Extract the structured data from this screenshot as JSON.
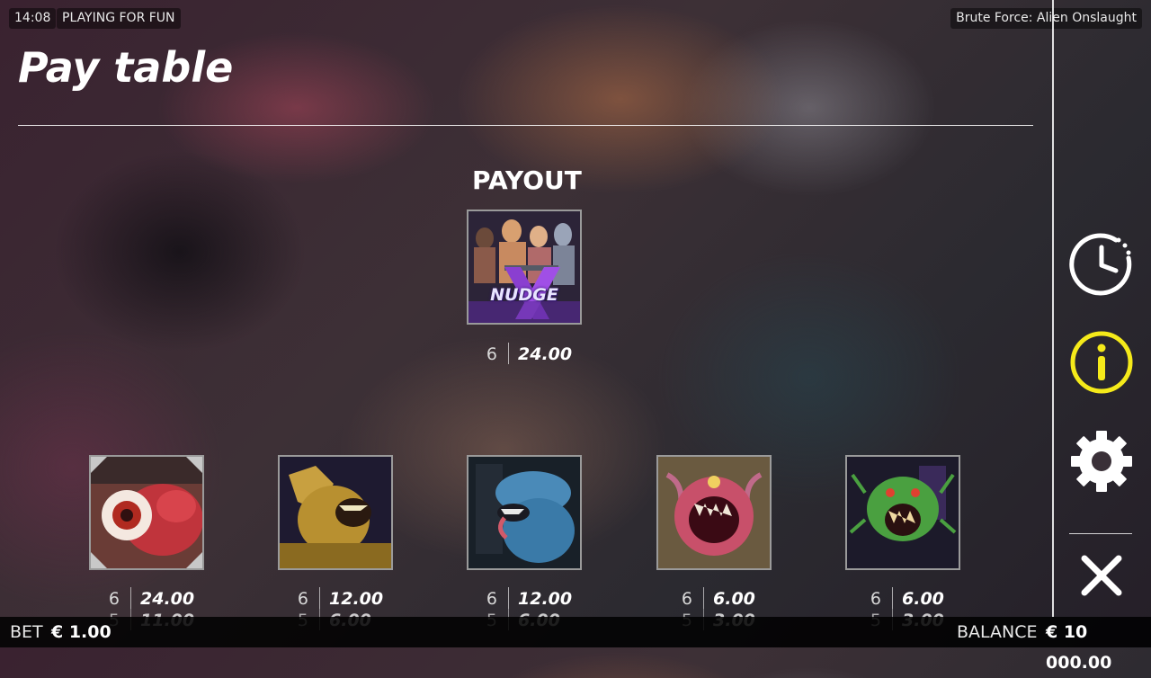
{
  "status": {
    "clock": "14:08",
    "mode": "PLAYING FOR FUN",
    "game_title": "Brute Force: Alien Onslaught"
  },
  "page": {
    "title": "Pay table"
  },
  "payout": {
    "heading": "PAYOUT",
    "feature_symbol": {
      "icon": "heroes-nudge-symbol",
      "tile_text": "NUDGE",
      "count": "6",
      "amount": "24.00"
    }
  },
  "symbols": [
    {
      "icon": "red-eye-alien-symbol",
      "count": "6",
      "amount": "24.00",
      "count_2": "5",
      "amount_2": "11.00"
    },
    {
      "icon": "yellow-beast-alien-symbol",
      "count": "6",
      "amount": "12.00",
      "count_2": "5",
      "amount_2": "6.00"
    },
    {
      "icon": "blue-xeno-alien-symbol",
      "count": "6",
      "amount": "12.00",
      "count_2": "5",
      "amount_2": "6.00"
    },
    {
      "icon": "pink-maw-alien-symbol",
      "count": "6",
      "amount": "6.00",
      "count_2": "5",
      "amount_2": "3.00"
    },
    {
      "icon": "green-bug-alien-symbol",
      "count": "6",
      "amount": "6.00",
      "count_2": "5",
      "amount_2": "3.00"
    }
  ],
  "side_menu": [
    {
      "icon": "history-clock-icon",
      "color": "#ffffff"
    },
    {
      "icon": "info-icon",
      "color": "#f5ea1a",
      "active": true
    },
    {
      "icon": "settings-gear-icon",
      "color": "#ffffff"
    },
    {
      "icon": "close-icon",
      "color": "#ffffff"
    }
  ],
  "footer": {
    "bet_label": "BET",
    "bet_value": "€ 1.00",
    "balance_label": "BALANCE",
    "balance_value": "€ 10 000.00"
  }
}
